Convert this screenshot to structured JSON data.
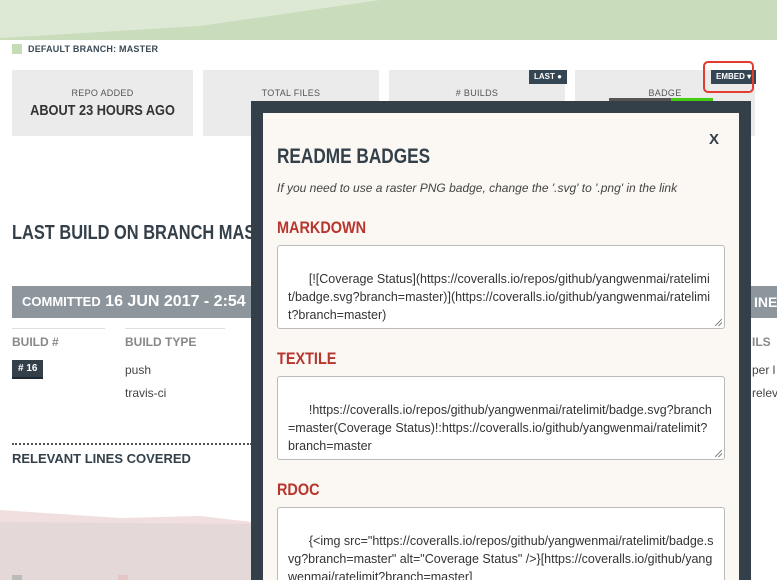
{
  "branch": {
    "label": "DEFAULT BRANCH: MASTER"
  },
  "stats": [
    {
      "label": "REPO ADDED",
      "value": "ABOUT 23 HOURS AGO"
    },
    {
      "label": "TOTAL FILES",
      "value": ""
    },
    {
      "label": "# BUILDS",
      "value": ""
    },
    {
      "label": "BADGE",
      "value": ""
    }
  ],
  "buttons": {
    "last": "LAST",
    "embed": "EMBED"
  },
  "last_build": {
    "title": "LAST BUILD ON BRANCH MAST"
  },
  "committed": {
    "label": "COMMITTED",
    "date": "16 JUN 2017 - 2:54"
  },
  "columns": {
    "build_num": "BUILD #",
    "build_type": "BUILD TYPE"
  },
  "build": {
    "number": "# 16",
    "type": "push",
    "service": "travis-ci"
  },
  "relevant": {
    "title": "RELEVANT LINES COVERED"
  },
  "right_fragments": {
    "bar_text": "INE",
    "col": "ILS",
    "line1": "per l",
    "line2": "relev"
  },
  "modal": {
    "close": "X",
    "title": "README BADGES",
    "subtitle": "If you need to use a raster PNG badge, change the '.svg' to '.png' in the link",
    "sections": [
      {
        "title": "MARKDOWN",
        "code": "[![Coverage Status](https://coveralls.io/repos/github/yangwenmai/ratelimit/badge.svg?branch=master)](https://coveralls.io/github/yangwenmai/ratelimit?branch=master)"
      },
      {
        "title": "TEXTILE",
        "code": "!https://coveralls.io/repos/github/yangwenmai/ratelimit/badge.svg?branch=master(Coverage Status)!:https://coveralls.io/github/yangwenmai/ratelimit?branch=master"
      },
      {
        "title": "RDOC",
        "code": "{<img src=\"https://coveralls.io/repos/github/yangwenmai/ratelimit/badge.svg?branch=master\" alt=\"Coverage Status\" />}[https://coveralls.io/github/yangwenmai/ratelimit?branch=master]"
      }
    ]
  },
  "colors": {
    "dark": "#33404a",
    "accent_red": "#b8352e",
    "highlight": "#e23b2f",
    "modal_bg": "#fbf7f2"
  }
}
